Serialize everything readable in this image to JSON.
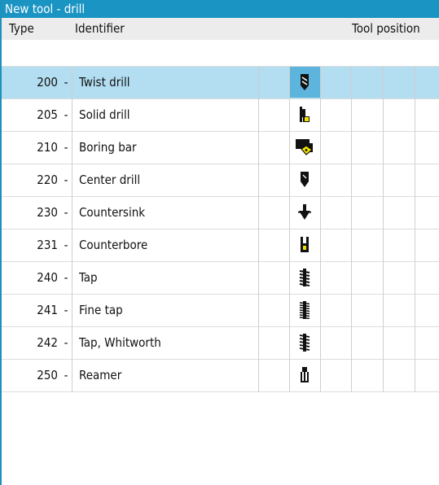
{
  "window": {
    "title": "New tool - drill"
  },
  "columns": {
    "type": "Type",
    "identifier": "Identifier",
    "tool_position": "Tool position"
  },
  "tools": [
    {
      "type": "200",
      "sep": "-",
      "identifier": "Twist drill",
      "icon": "twist-drill-icon",
      "selected": true
    },
    {
      "type": "205",
      "sep": "-",
      "identifier": "Solid drill",
      "icon": "solid-drill-icon",
      "selected": false
    },
    {
      "type": "210",
      "sep": "-",
      "identifier": "Boring bar",
      "icon": "boring-bar-icon",
      "selected": false
    },
    {
      "type": "220",
      "sep": "-",
      "identifier": "Center drill",
      "icon": "center-drill-icon",
      "selected": false
    },
    {
      "type": "230",
      "sep": "-",
      "identifier": "Countersink",
      "icon": "countersink-icon",
      "selected": false
    },
    {
      "type": "231",
      "sep": "-",
      "identifier": "Counterbore",
      "icon": "counterbore-icon",
      "selected": false
    },
    {
      "type": "240",
      "sep": "-",
      "identifier": "Tap",
      "icon": "tap-icon",
      "selected": false
    },
    {
      "type": "241",
      "sep": "-",
      "identifier": "Fine tap",
      "icon": "fine-tap-icon",
      "selected": false
    },
    {
      "type": "242",
      "sep": "-",
      "identifier": "Tap, Whitworth",
      "icon": "tap-whitworth-icon",
      "selected": false
    },
    {
      "type": "250",
      "sep": "-",
      "identifier": "Reamer",
      "icon": "reamer-icon",
      "selected": false
    }
  ],
  "colors": {
    "titlebar": "#1a94c3",
    "selected_row": "#b3ddf0",
    "selected_icon_cell": "#5db4dc",
    "tool_yellow": "#f2e200"
  }
}
